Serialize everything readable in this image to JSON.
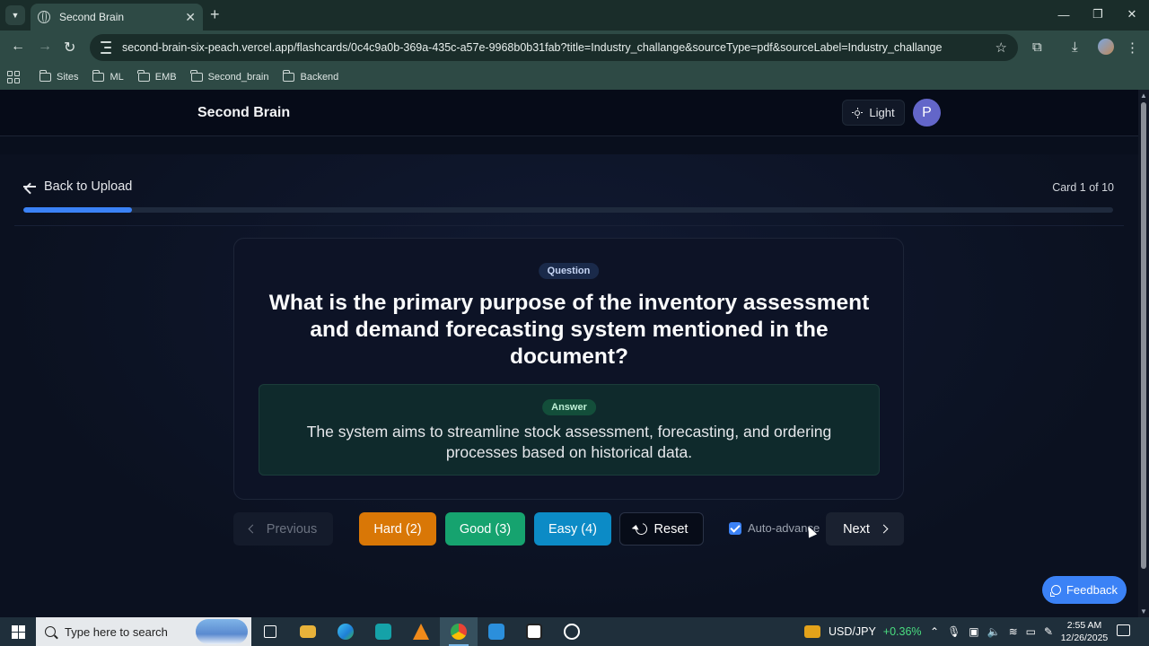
{
  "browser": {
    "tab_title": "Second Brain",
    "tab_close": "✕",
    "new_tab": "+",
    "url": "second-brain-six-peach.vercel.app/flashcards/0c4c9a0b-369a-435c-a57e-9968b0b31fab?title=Industry_challange&sourceType=pdf&sourceLabel=Industry_challange",
    "bookmarks": [
      "Sites",
      "ML",
      "EMB",
      "Second_brain",
      "Backend"
    ],
    "window_controls": [
      "—",
      "❐",
      "✕"
    ]
  },
  "app": {
    "brand": "Second Brain",
    "theme_label": "Light",
    "avatar_initial": "P"
  },
  "flashcards": {
    "back_label": "Back to Upload",
    "card_counter": "Card 1 of 10",
    "progress_fraction": 0.1,
    "question_badge": "Question",
    "question": "What is the primary purpose of the inventory assessment and demand forecasting system mentioned in the document?",
    "answer_badge": "Answer",
    "answer": "The system aims to streamline stock assessment, forecasting, and ordering processes based on historical data.",
    "buttons": {
      "previous": "Previous",
      "hard": "Hard (2)",
      "good": "Good (3)",
      "easy": "Easy (4)",
      "reset": "Reset",
      "next": "Next"
    },
    "auto_advance_label": "Auto-advance",
    "auto_advance_checked": true,
    "feedback_label": "Feedback"
  },
  "taskbar": {
    "search_placeholder": "Type here to search",
    "ticker_symbol": "USD/JPY",
    "ticker_change": "+0.36%",
    "time": "2:55 AM",
    "date": "12/26/2025"
  },
  "colors": {
    "accent": "#3b82f6",
    "hard": "#d97706",
    "good": "#16a36f",
    "easy": "#0c8bc6",
    "avatar": "#6366c9"
  }
}
